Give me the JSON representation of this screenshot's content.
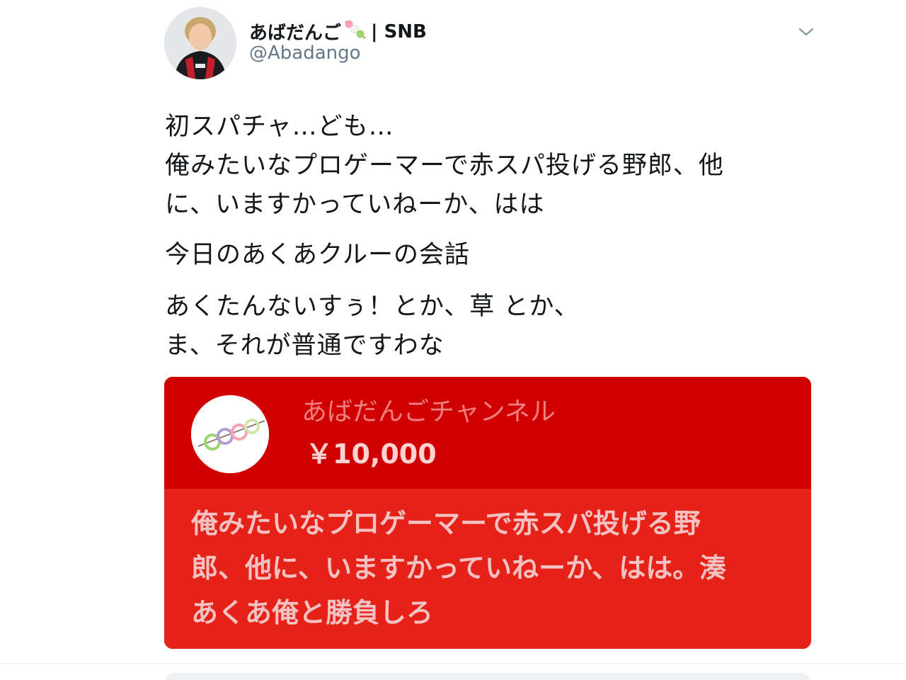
{
  "tweet": {
    "display_name": "あばだんご",
    "name_suffix": "| SNB",
    "handle": "@Abadango",
    "lines": [
      "初スパチャ…ども…",
      "俺みたいなプロゲーマーで赤スパ投げる野郎、他",
      "に、いますかっていねーか、はは",
      "今日のあくあクルーの会話",
      "あくたんないすぅ！とか、草 とか、",
      "ま、それが普通ですわな"
    ]
  },
  "superchat": {
    "channel_name": "あばだんごチャンネル",
    "amount": "￥10,000",
    "message_lines": [
      "俺みたいなプロゲーマーで赤スパ投げる野",
      "郎、他に、いますかっていねーか、はは。湊",
      "あくあ俺と勝負しろ"
    ],
    "header_color": "#d00000",
    "body_color": "#e62117"
  },
  "icons": {
    "emoji": "dango-emoji-icon",
    "menu": "chevron-down-icon"
  }
}
